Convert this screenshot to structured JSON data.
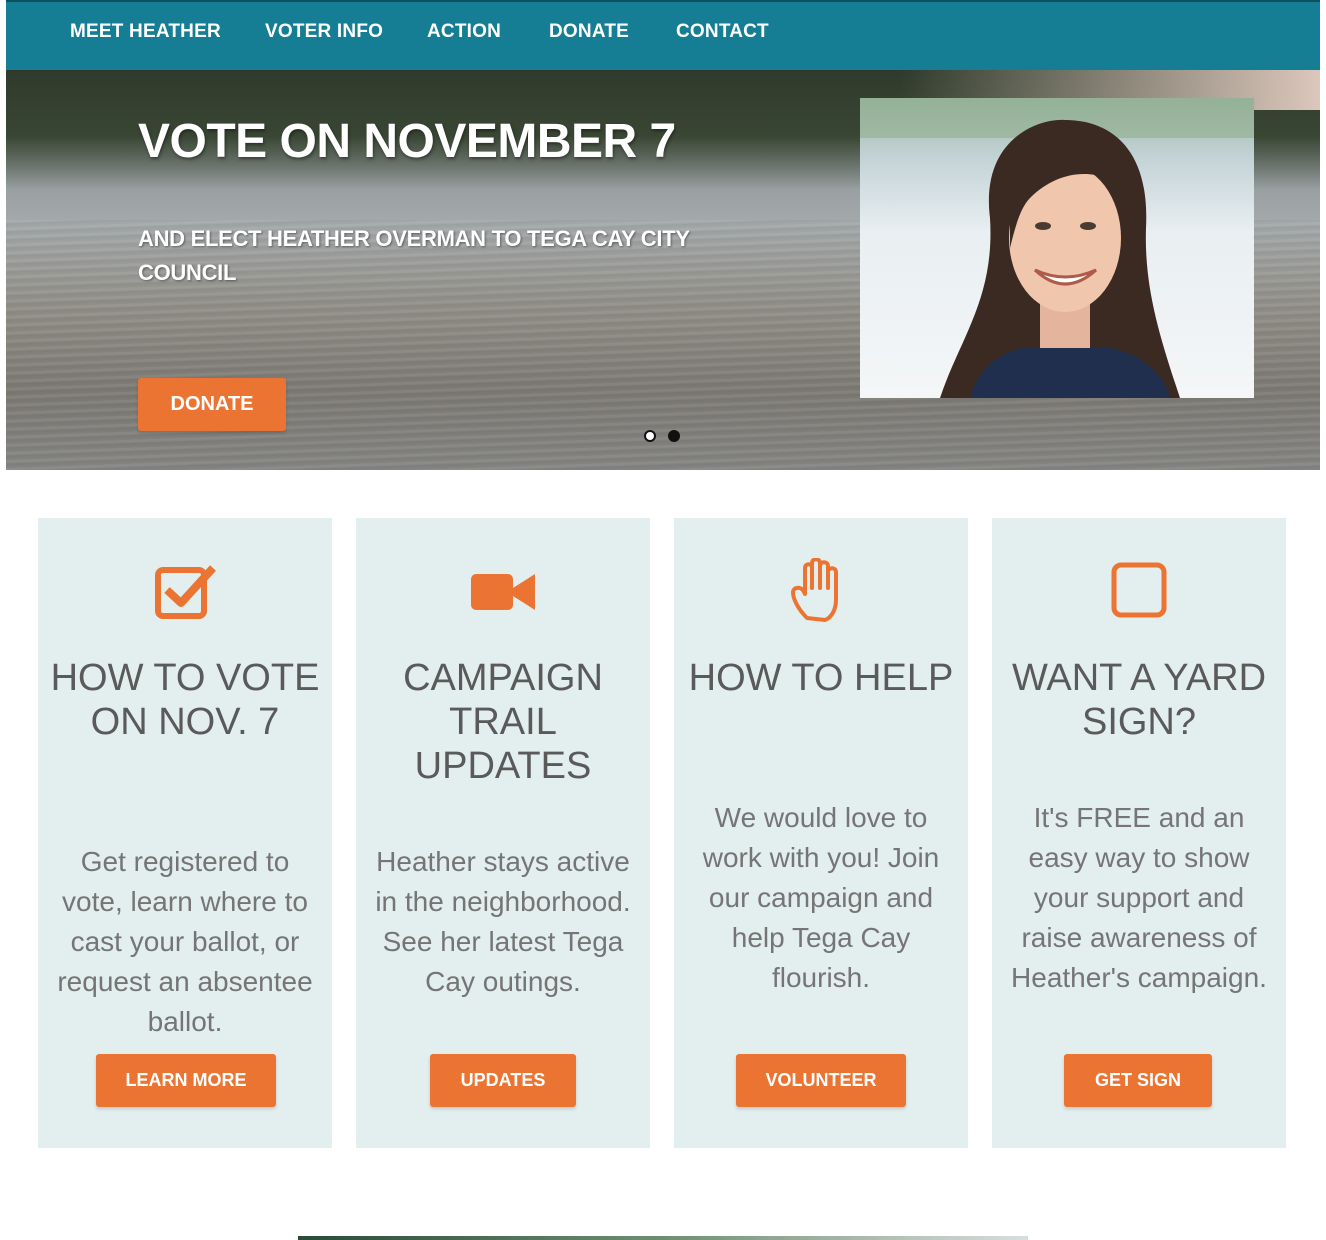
{
  "nav": {
    "items": [
      "MEET HEATHER",
      "VOTER INFO",
      "ACTION",
      "DONATE",
      "CONTACT"
    ]
  },
  "hero": {
    "title": "VOTE ON NOVEMBER 7",
    "subtitle": "AND ELECT HEATHER OVERMAN TO TEGA CAY CITY COUNCIL",
    "button": "DONATE",
    "slide_count": 2,
    "active_slide": 2
  },
  "cards": [
    {
      "icon": "checkbox-checked-icon",
      "title": "HOW TO VOTE ON NOV. 7",
      "text": "Get registered to vote, learn where to cast your ballot, or request an absentee ballot.",
      "button": "LEARN MORE"
    },
    {
      "icon": "video-camera-icon",
      "title": "CAMPAIGN TRAIL UPDATES",
      "text": "Heather stays active in the neighborhood. See her latest Tega Cay outings.",
      "button": "UPDATES"
    },
    {
      "icon": "hand-icon",
      "title": "HOW TO HELP",
      "text": "We would love to work with you! Join our campaign and help Tega Cay flourish.",
      "button": "VOLUNTEER"
    },
    {
      "icon": "square-icon",
      "title": "WANT A YARD SIGN?",
      "text": "It's FREE and an easy way to show your support and raise awareness of Heather's campaign.",
      "button": "GET SIGN"
    }
  ],
  "colors": {
    "nav_bg": "#157d94",
    "accent": "#ec7432",
    "card_bg": "#e3eeee",
    "title_text": "#5a5a5a",
    "body_text": "#757575"
  }
}
